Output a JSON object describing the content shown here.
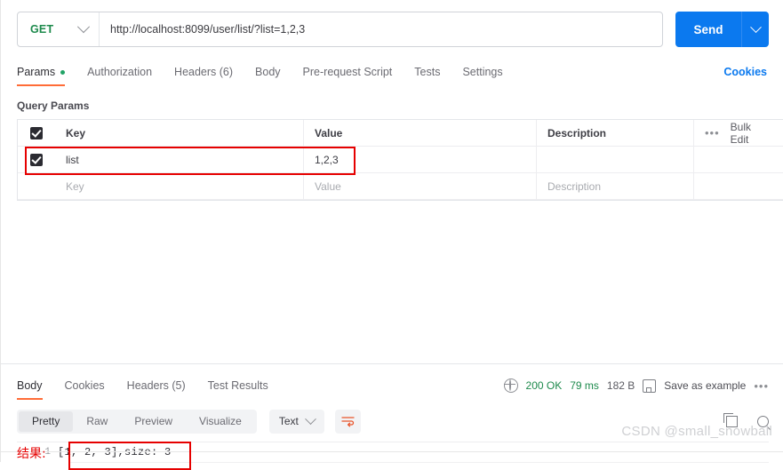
{
  "request": {
    "method": "GET",
    "url": "http://localhost:8099/user/list/?list=1,2,3",
    "send_label": "Send",
    "tabs": [
      {
        "label": "Params",
        "active": true,
        "has_dot": true
      },
      {
        "label": "Authorization",
        "active": false,
        "has_dot": false
      },
      {
        "label": "Headers (6)",
        "active": false,
        "has_dot": false
      },
      {
        "label": "Body",
        "active": false,
        "has_dot": false
      },
      {
        "label": "Pre-request Script",
        "active": false,
        "has_dot": false
      },
      {
        "label": "Tests",
        "active": false,
        "has_dot": false
      },
      {
        "label": "Settings",
        "active": false,
        "has_dot": false
      }
    ],
    "cookies_link": "Cookies"
  },
  "query_params": {
    "section_title": "Query Params",
    "headers": {
      "key": "Key",
      "value": "Value",
      "description": "Description",
      "bulk_edit": "Bulk Edit"
    },
    "rows": [
      {
        "checked": true,
        "key": "list",
        "value": "1,2,3",
        "description": "",
        "highlighted": true
      },
      {
        "checked": false,
        "key": "Key",
        "value": "Value",
        "description": "Description",
        "placeholder": true
      }
    ]
  },
  "response": {
    "tabs": [
      {
        "label": "Body",
        "active": true
      },
      {
        "label": "Cookies",
        "active": false
      },
      {
        "label": "Headers (5)",
        "active": false
      },
      {
        "label": "Test Results",
        "active": false
      }
    ],
    "status": "200 OK",
    "time": "79 ms",
    "size": "182 B",
    "save_as_example": "Save as example",
    "format_tabs": [
      {
        "label": "Pretty",
        "active": true
      },
      {
        "label": "Raw",
        "active": false
      },
      {
        "label": "Preview",
        "active": false
      },
      {
        "label": "Visualize",
        "active": false
      }
    ],
    "content_type": "Text",
    "body_lines": [
      {
        "number": "1",
        "text": "[1, 2, 3],size: 3"
      }
    ],
    "annotation": "结果:"
  },
  "watermark": "CSDN @small_snowball",
  "colors": {
    "accent_orange": "#ff6c37",
    "send_blue": "#0b79ef",
    "method_green": "#1d8a4c",
    "highlight_red": "#e60000"
  }
}
